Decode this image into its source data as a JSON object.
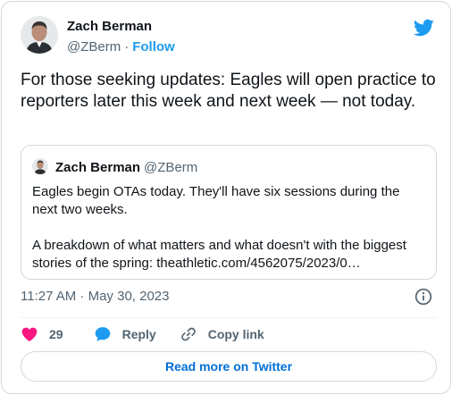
{
  "author": {
    "name": "Zach Berman",
    "handle": "@ZBerm",
    "separator": "·",
    "follow_label": "Follow"
  },
  "tweet": {
    "text": "For those seeking updates: Eagles will open practice to reporters later this week and next week — not today.",
    "time": "11:27 AM · May 30, 2023"
  },
  "quoted_tweet": {
    "name": "Zach Berman",
    "handle": "@ZBerm",
    "paragraph_1": "Eagles begin OTAs today. They'll have six sessions during the next two weeks.",
    "paragraph_2": "A breakdown of what matters and what doesn't with the biggest stories of the spring: theathletic.com/4562075/2023/0…"
  },
  "actions": {
    "like_count": "29",
    "reply_label": "Reply",
    "copy_label": "Copy link"
  },
  "read_more_label": "Read more on Twitter",
  "icons": {
    "brand": "twitter-bird-icon",
    "info": "info-icon",
    "like": "heart-icon",
    "reply": "speech-bubble-icon",
    "copy": "link-icon"
  },
  "colors": {
    "accent": "#1d9bf0",
    "like": "#f91880",
    "link": "#006fd6",
    "secondary_text": "#536471",
    "border": "#cfd9de"
  }
}
